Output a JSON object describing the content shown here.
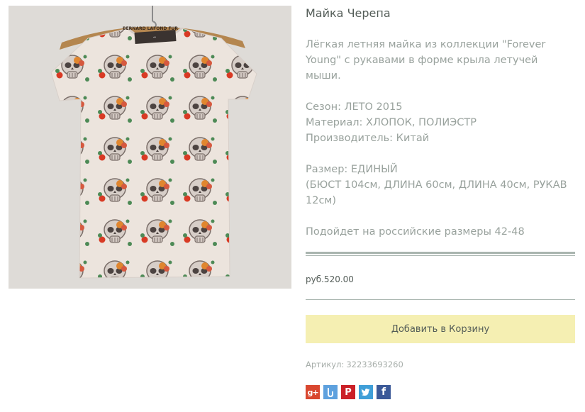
{
  "product": {
    "title": "Майка Черепа",
    "image_alt": "Майка Черепа",
    "description": {
      "intro": "Лёгкая летняя майка из коллекции \"Forever Young\" с рукавами в форме крыла летучей мыши.",
      "season": "Сезон: ЛЕТО 2015",
      "material": "Материал: ХЛОПОК, ПОЛИЭСТР",
      "manufacturer": "Производитель: Китай",
      "size": "Размер: ЕДИНЫЙ",
      "dimensions": "(БЮСТ 104см, ДЛИНА 60см, ДЛИНА 40см, РУКАВ 12см)",
      "fit_note": "Подойдет на российские размеры 42-48"
    },
    "price": "руб.520.00",
    "add_to_cart_label": "Добавить в Корзину",
    "sku_label": "Артикул:",
    "sku_value": "32233693260",
    "label_brand": "BERNARD LAFOND FUR"
  },
  "share": [
    {
      "name": "google-plus",
      "glyph": "g+",
      "color": "#d9472f"
    },
    {
      "name": "livejournal",
      "glyph": "",
      "color": "#5ea1de"
    },
    {
      "name": "pinterest",
      "glyph": "P",
      "color": "#cb2027"
    },
    {
      "name": "twitter",
      "glyph": "",
      "color": "#3f9fd8"
    },
    {
      "name": "facebook",
      "glyph": "f",
      "color": "#3b5998"
    }
  ],
  "colors": {
    "title": "#545d58",
    "text": "#99a29d",
    "button_bg": "#f5efb2",
    "rule": "#a9b5af"
  }
}
